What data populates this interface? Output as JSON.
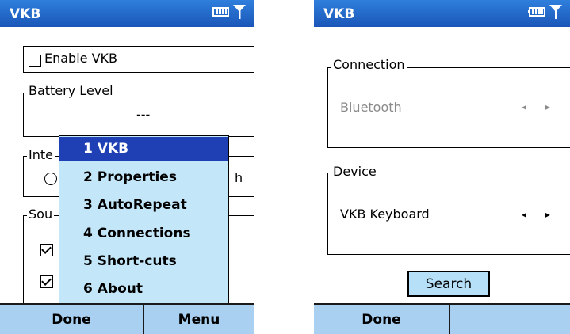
{
  "left": {
    "title": "VKB",
    "enable_label": "Enable VKB",
    "battery_label": "Battery Level",
    "battery_value": "---",
    "interface_label": "Inte",
    "sound_label": "Sou",
    "radio_fragment": "h",
    "menu": {
      "items": [
        {
          "label": "1 VKB",
          "selected": true
        },
        {
          "label": "2 Properties",
          "selected": false
        },
        {
          "label": "3 AutoRepeat",
          "selected": false
        },
        {
          "label": "4 Connections",
          "selected": false
        },
        {
          "label": "5 Short-cuts",
          "selected": false
        },
        {
          "label": "6 About",
          "selected": false
        }
      ]
    },
    "softkeys": {
      "left": "Done",
      "right": "Menu"
    }
  },
  "right": {
    "title": "VKB",
    "connection_label": "Connection",
    "connection_value": "Bluetooth",
    "device_label": "Device",
    "device_value": "VKB Keyboard",
    "arrows": "◂ ▸",
    "search_label": "Search",
    "softkeys": {
      "left": "Done",
      "right": ""
    }
  },
  "colors": {
    "titlebar": "#1a56b8",
    "softbar": "#a9d0f0",
    "menu_bg": "#c3e6f9",
    "menu_selected": "#1f3fb5"
  }
}
